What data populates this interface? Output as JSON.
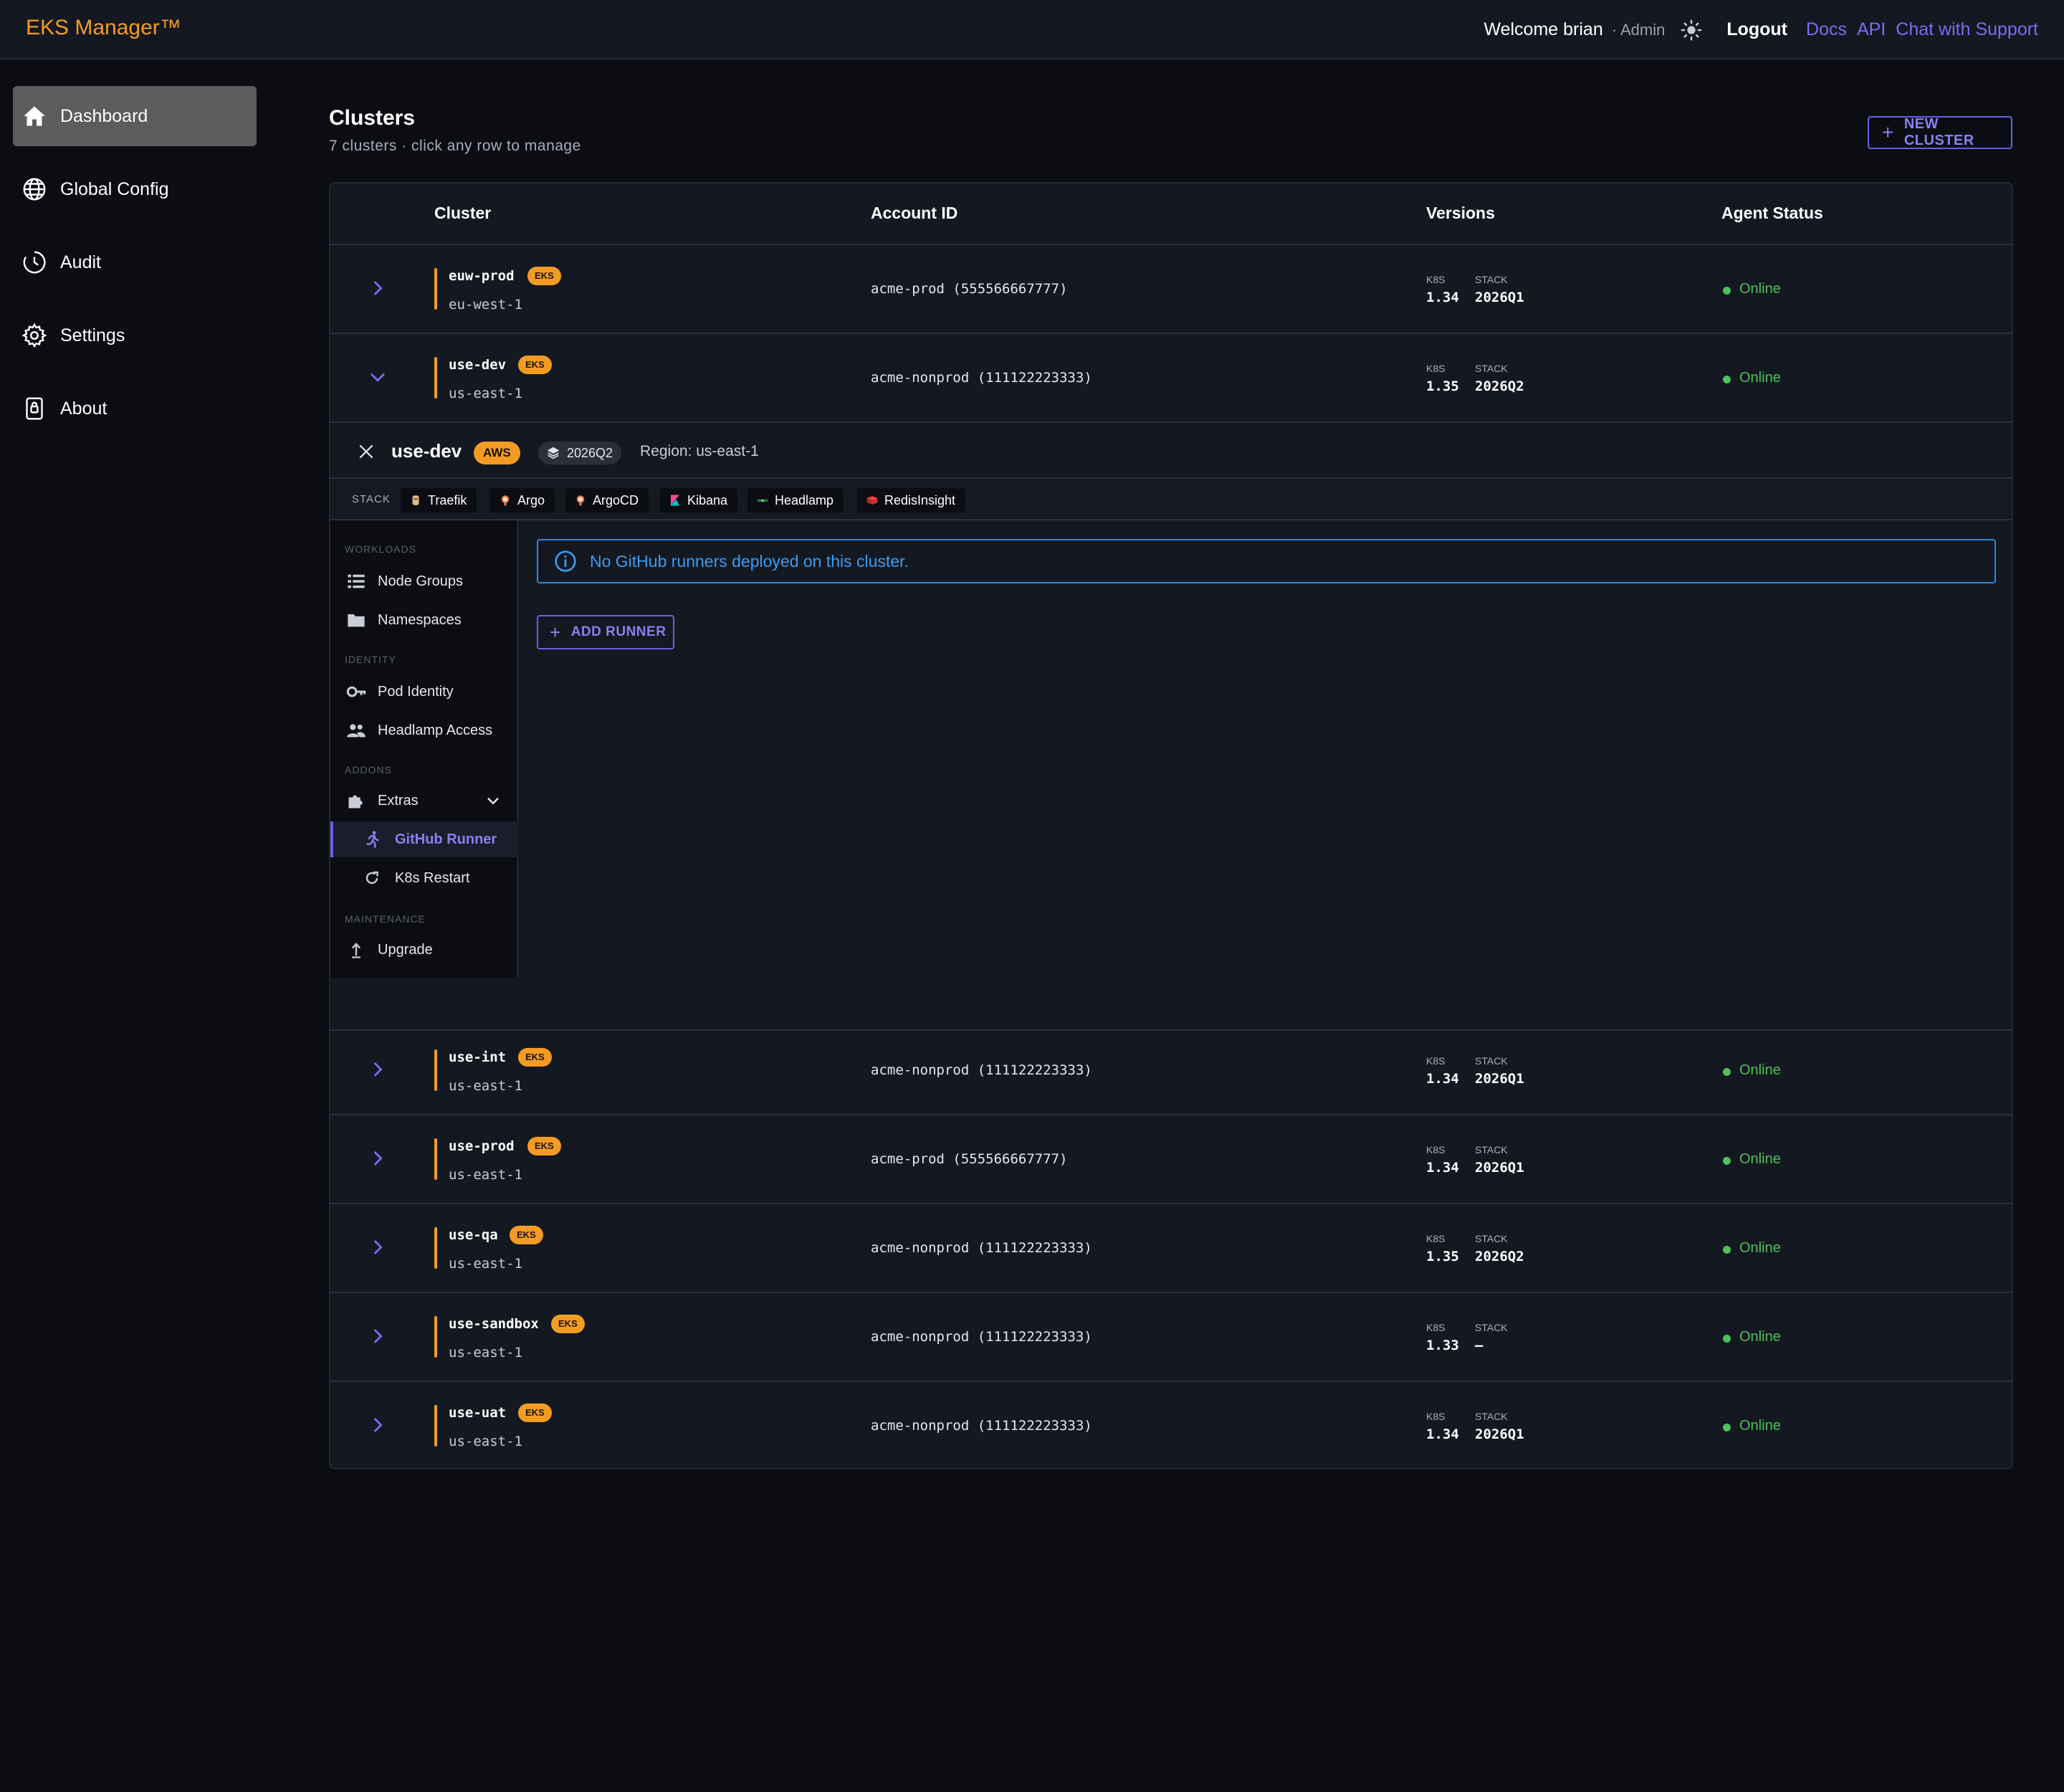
{
  "header": {
    "brand": "EKS Manager™",
    "welcome": "Welcome brian",
    "role": "· Admin",
    "logout": "Logout",
    "links": [
      "Docs",
      "API",
      "Chat with Support"
    ]
  },
  "sidebar": {
    "items": [
      {
        "label": "Dashboard",
        "icon": "home-icon",
        "active": true
      },
      {
        "label": "Global Config",
        "icon": "globe-icon"
      },
      {
        "label": "Audit",
        "icon": "clock-icon"
      },
      {
        "label": "Settings",
        "icon": "gear-icon"
      },
      {
        "label": "About",
        "icon": "lock-icon"
      }
    ]
  },
  "main": {
    "title": "Clusters",
    "subtitle": "7 clusters · click any row to manage",
    "new_cluster_label": "NEW CLUSTER"
  },
  "table": {
    "columns": [
      "Cluster",
      "Account ID",
      "Versions",
      "Agent Status"
    ],
    "version_labels": {
      "k8s": "K8S",
      "stack": "STACK"
    },
    "rows": [
      {
        "name": "euw-prod",
        "badge": "EKS",
        "region": "eu-west-1",
        "account": "acme-prod (555566667777)",
        "k8s": "1.34",
        "stack": "2026Q1",
        "status": "Online"
      },
      {
        "name": "use-dev",
        "badge": "EKS",
        "region": "us-east-1",
        "account": "acme-nonprod (111122223333)",
        "k8s": "1.35",
        "stack": "2026Q2",
        "status": "Online"
      },
      {
        "name": "use-int",
        "badge": "EKS",
        "region": "us-east-1",
        "account": "acme-nonprod (111122223333)",
        "k8s": "1.34",
        "stack": "2026Q1",
        "status": "Online"
      },
      {
        "name": "use-prod",
        "badge": "EKS",
        "region": "us-east-1",
        "account": "acme-prod (555566667777)",
        "k8s": "1.34",
        "stack": "2026Q1",
        "status": "Online"
      },
      {
        "name": "use-qa",
        "badge": "EKS",
        "region": "us-east-1",
        "account": "acme-nonprod (111122223333)",
        "k8s": "1.35",
        "stack": "2026Q2",
        "status": "Online"
      },
      {
        "name": "use-sandbox",
        "badge": "EKS",
        "region": "us-east-1",
        "account": "acme-nonprod (111122223333)",
        "k8s": "1.33",
        "stack": "—",
        "status": "Online"
      },
      {
        "name": "use-uat",
        "badge": "EKS",
        "region": "us-east-1",
        "account": "acme-nonprod (111122223333)",
        "k8s": "1.34",
        "stack": "2026Q1",
        "status": "Online"
      }
    ]
  },
  "expanded": {
    "name": "use-dev",
    "badge": "AWS",
    "stack_version": "2026Q2",
    "region": "Region: us-east-1",
    "stack_label": "STACK",
    "stack_items": [
      "Traefik",
      "Argo",
      "ArgoCD",
      "Kibana",
      "Headlamp",
      "RedisInsight"
    ],
    "nav": {
      "workloads": "WORKLOADS",
      "node_groups": "Node Groups",
      "namespaces": "Namespaces",
      "identity": "IDENTITY",
      "pod_identity": "Pod Identity",
      "headlamp_access": "Headlamp Access",
      "addons": "ADDONS",
      "extras": "Extras",
      "github_runner": "GitHub Runner",
      "k8s_restart": "K8s Restart",
      "maintenance": "MAINTENANCE",
      "upgrade": "Upgrade"
    },
    "info_message": "No GitHub runners deployed on this cluster.",
    "add_runner_label": "ADD RUNNER"
  },
  "colors": {
    "accent": "#6b5ee6",
    "brand": "#f39c24",
    "online": "#4fc15a",
    "info": "#2f88e0"
  }
}
